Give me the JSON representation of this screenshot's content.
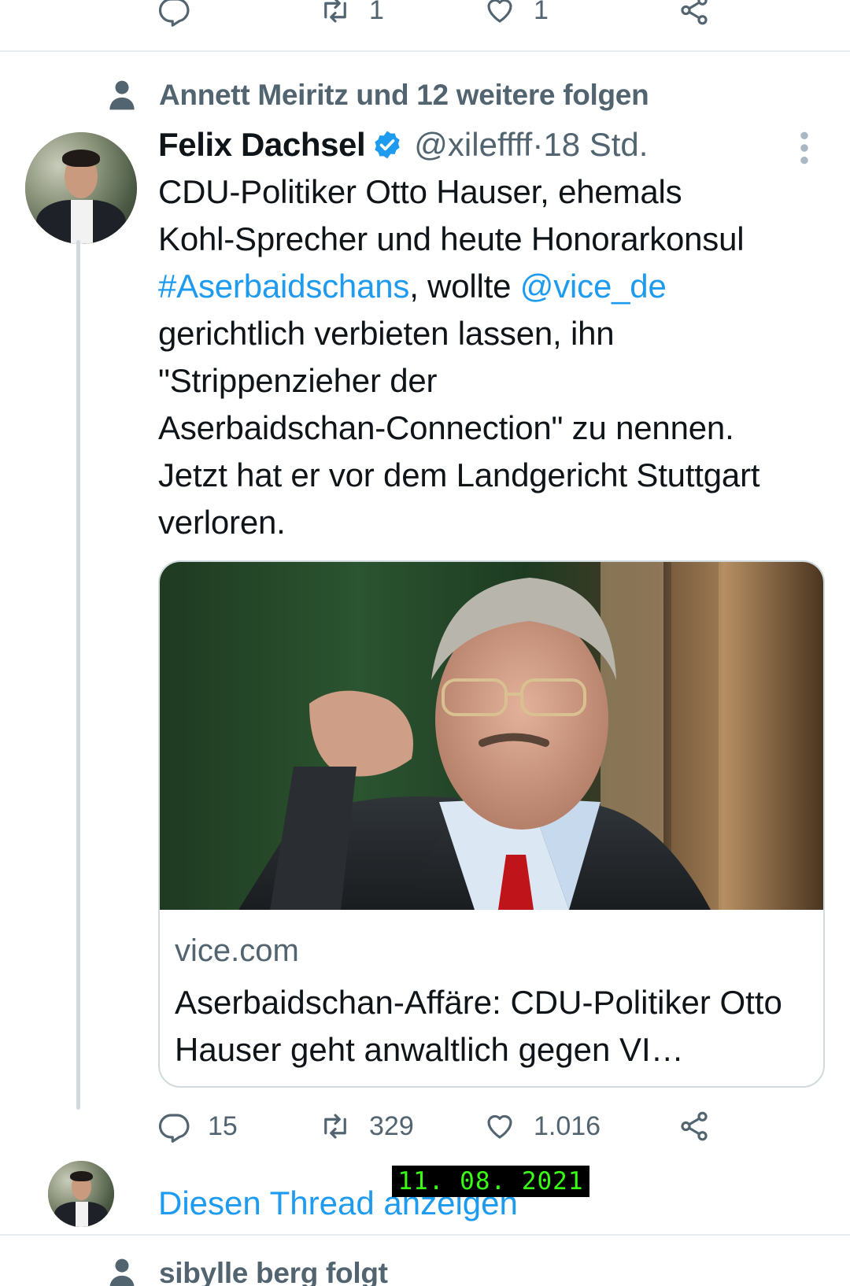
{
  "previous_tweet": {
    "retweets": "1",
    "likes": "1"
  },
  "tweet": {
    "social_context": "Annett Meiritz und 12 weitere folgen",
    "author_name": "Felix Dachsel",
    "author_handle": "@xileffff",
    "separator": " · ",
    "time": "18 Std.",
    "text_line1": "CDU-Politiker Otto Hauser, ehemals",
    "text_line2": "Kohl-Sprecher und heute Honorarkonsul",
    "hashtag": "#Aserbaidschans",
    "text_mid": ", wollte ",
    "mention": "@vice_de",
    "text_line4": "gerichtlich verbieten lassen, ihn",
    "text_line5": "\"Strippenzieher der",
    "text_line6": "Aserbaidschan-Connection\" zu nennen.",
    "text_line7": "Jetzt hat er vor dem Landgericht Stuttgart",
    "text_line8": "verloren.",
    "card": {
      "domain": "vice.com",
      "title": "Aserbaidschan-Affäre: CDU-Politiker Otto Hauser geht anwaltlich gegen VI…"
    },
    "replies": "15",
    "retweets": "329",
    "likes": "1.016"
  },
  "thread_link": "Diesen Thread anzeigen",
  "date_stamp": "11. 08. 2021",
  "next_tweet": {
    "social_context": "sibylle berg folgt"
  },
  "colors": {
    "accent": "#1d9bf0",
    "muted": "#536471",
    "text": "#0f1419",
    "verified": "#1d9bf0",
    "stamp_text": "#39ff14"
  },
  "icons": [
    "reply-icon",
    "retweet-icon",
    "like-icon",
    "share-icon",
    "person-icon",
    "verified-icon",
    "more-icon"
  ]
}
